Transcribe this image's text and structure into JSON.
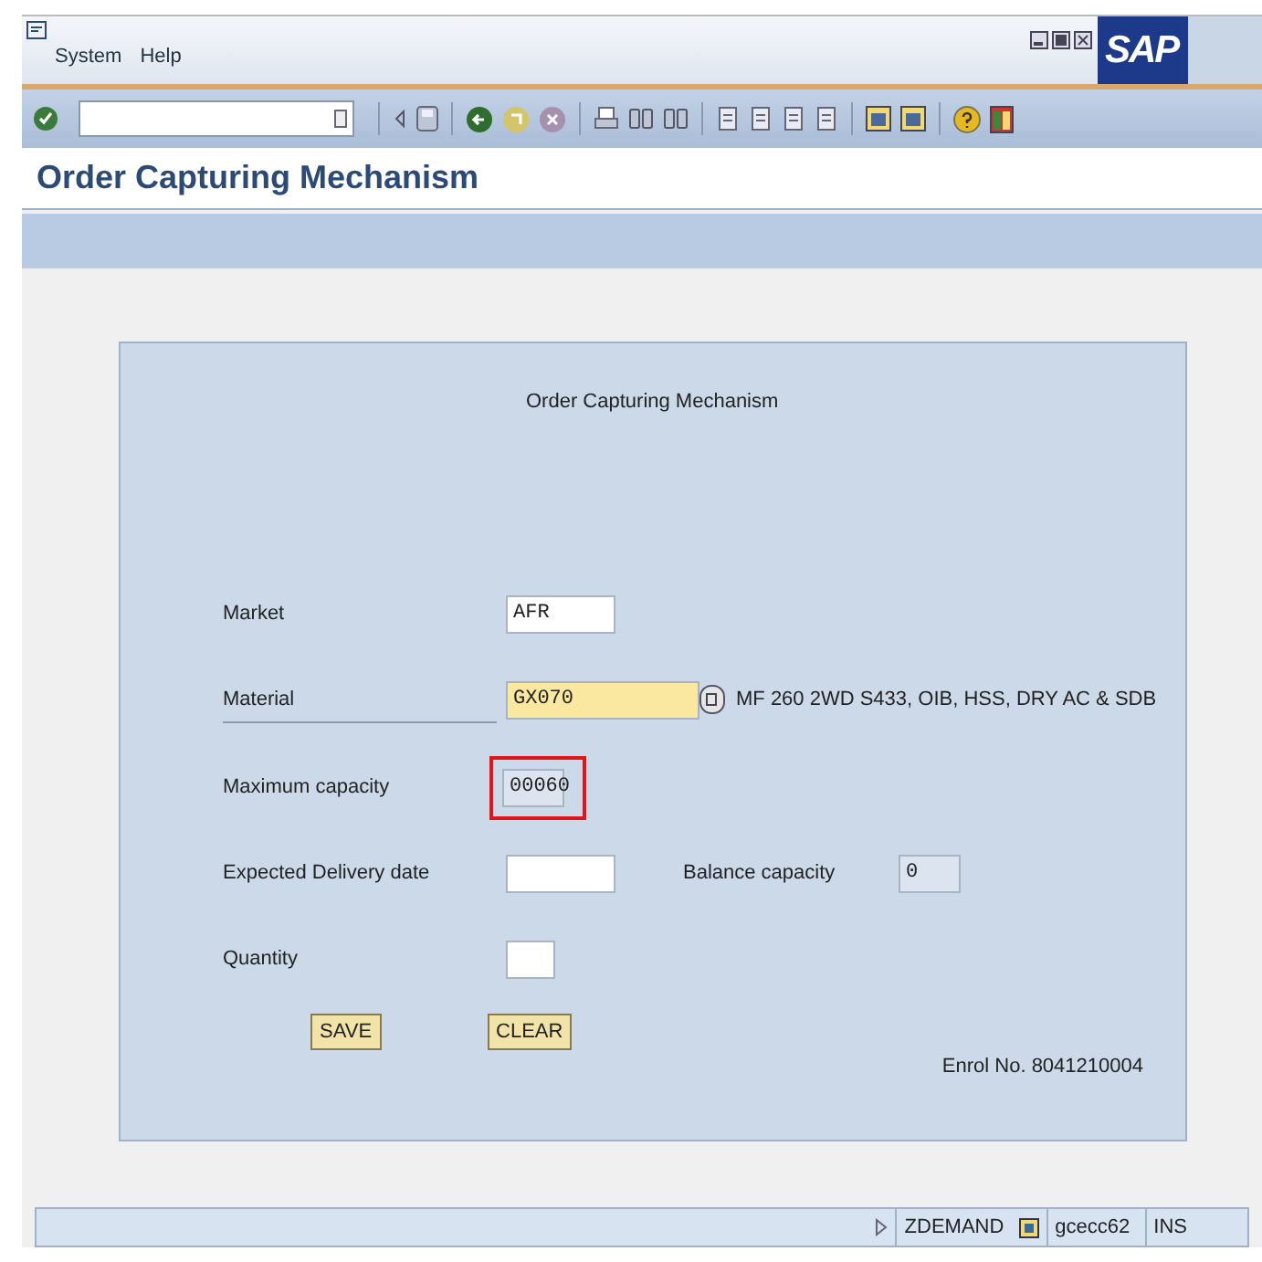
{
  "menu": [
    "System",
    "Help"
  ],
  "logo": "SAP",
  "title": "Order Capturing Mechanism",
  "form": {
    "heading": "Order Capturing Mechanism",
    "rows": [
      {
        "label": "Market",
        "field": {
          "value": "AFR",
          "readonly": false,
          "focused": false,
          "marked": false
        }
      },
      {
        "label": "Material",
        "field": {
          "value": "GX070",
          "readonly": false,
          "focused": true,
          "marked": false,
          "help": true
        },
        "description": "MF 260 2WD S433, OIB, HSS, DRY AC & SDB"
      },
      {
        "label": "Maximum capacity",
        "field": {
          "value": "00060",
          "readonly": true,
          "focused": false,
          "marked": true
        }
      },
      {
        "label": "Expected Delivery date",
        "field": {
          "readonly": false,
          "focused": false,
          "marked": false
        },
        "extra": {
          "label": "Balance capacity",
          "field": {
            "value": "0",
            "readonly": true
          }
        }
      },
      {
        "label": "Quantity",
        "field": {
          "readonly": false,
          "focused": false,
          "marked": false
        }
      }
    ],
    "buttons": [
      "SAVE",
      "CLEAR"
    ],
    "footer": "Enrol No. 8041210004"
  },
  "status_bar": {
    "transaction": "ZDEMAND",
    "server": "gcecc62",
    "mode": "INS"
  }
}
